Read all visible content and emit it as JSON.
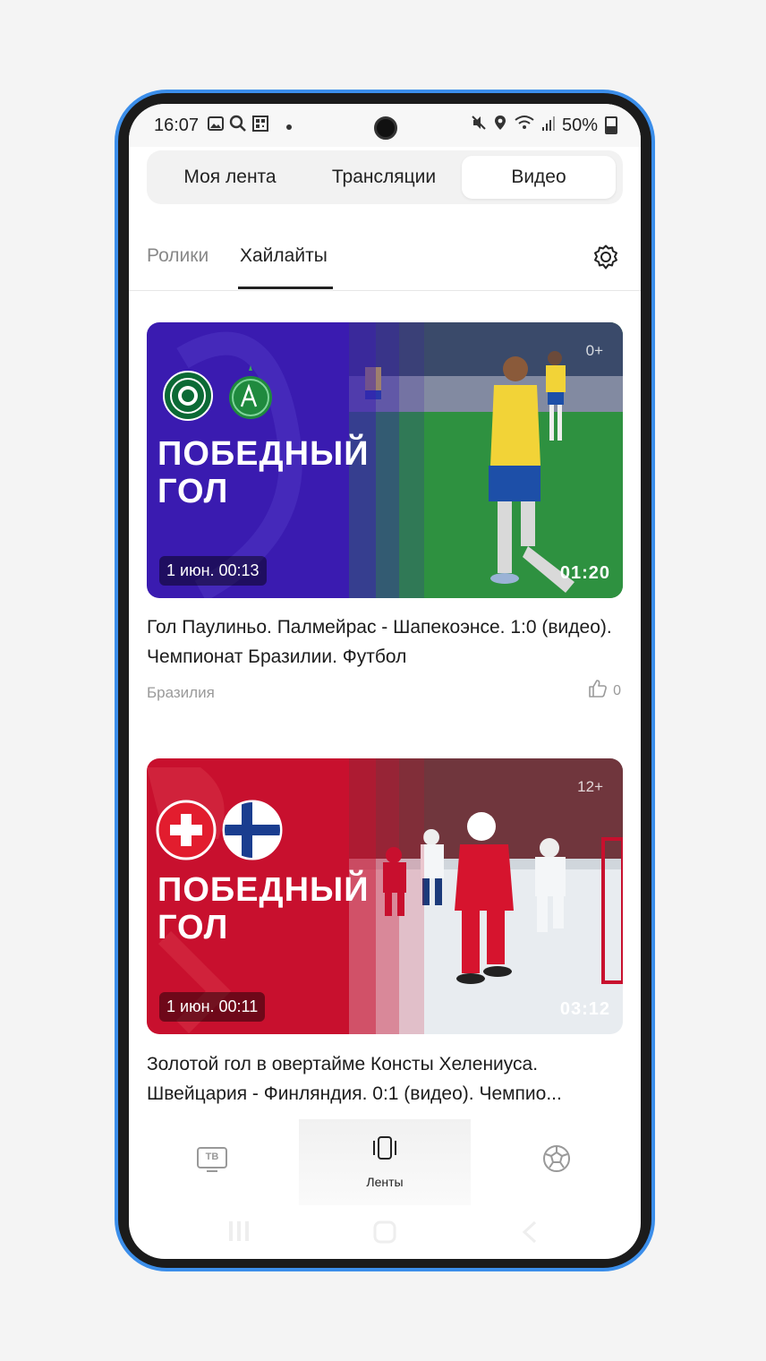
{
  "status_bar": {
    "time": "16:07",
    "battery": "50%",
    "icons_left": [
      "image-icon",
      "search-icon",
      "qr-icon",
      "dot-icon"
    ],
    "icons_right": [
      "mute-icon",
      "location-icon",
      "wifi-icon",
      "signal-icon",
      "battery-icon"
    ]
  },
  "top_tabs": [
    {
      "label": "Моя лента",
      "active": false
    },
    {
      "label": "Трансляции",
      "active": false
    },
    {
      "label": "Видео",
      "active": true
    }
  ],
  "sub_tabs": [
    {
      "label": "Ролики",
      "active": false
    },
    {
      "label": "Хайлайты",
      "active": true
    }
  ],
  "cards": [
    {
      "banner_title_line1": "ПОБЕДНЫЙ",
      "banner_title_line2": "ГОЛ",
      "date": "1 июн. 00:13",
      "duration": "01:20",
      "age_rating": "0+",
      "title": "Гол Паулиньо. Палмейрас - Шапекоэнсе. 1:0 (видео). Чемпионат Бразилии. Футбол",
      "category": "Бразилия",
      "likes": "0",
      "team_logos": [
        "palmeiras-logo",
        "chapecoense-logo"
      ],
      "colors": {
        "banner": "#3a1bb0",
        "field": "#2d8a34"
      }
    },
    {
      "banner_title_line1": "ПОБЕДНЫЙ",
      "banner_title_line2": "ГОЛ",
      "date": "1 июн. 00:11",
      "duration": "03:12",
      "age_rating": "12+",
      "title": "Золотой гол в овертайме Консты Хелениуса. Швейцария - Финляндия. 0:1 (видео). Чемпио...",
      "team_logos": [
        "switzerland-flag",
        "finland-flag"
      ],
      "colors": {
        "banner": "#c8102e",
        "rink": "#e8ecf0"
      }
    }
  ],
  "bottom_nav": [
    {
      "label": "",
      "icon": "tv-icon",
      "active": false
    },
    {
      "label": "Ленты",
      "icon": "feeds-icon",
      "active": true
    },
    {
      "label": "",
      "icon": "soccer-ball-icon",
      "active": false
    }
  ],
  "tv_icon_text": "ТВ",
  "colors": {
    "phone_frame": "#3b8eea",
    "text_primary": "#1c1c1c",
    "text_secondary": "#9a9a9a"
  }
}
